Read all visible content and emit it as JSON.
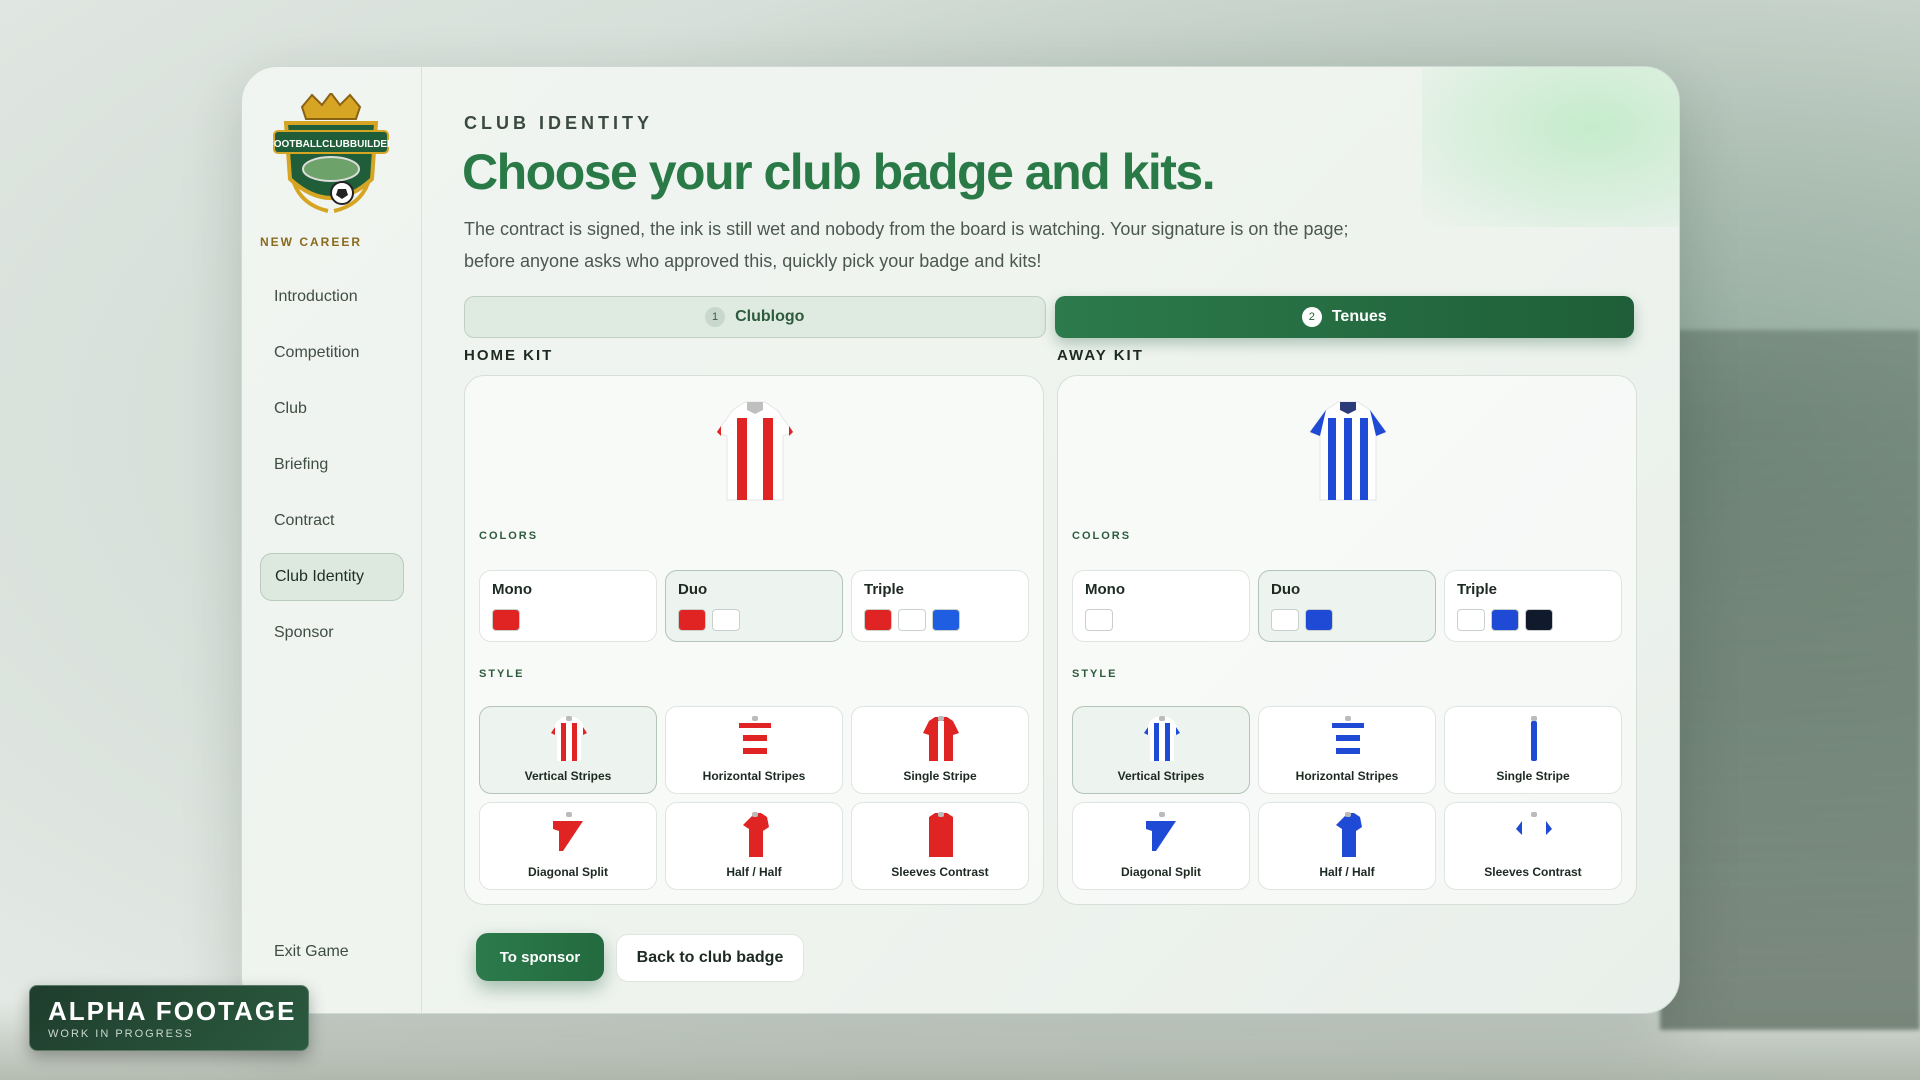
{
  "sidebar": {
    "new_career": "NEW CAREER",
    "items": [
      {
        "label": "Introduction",
        "active": false
      },
      {
        "label": "Competition",
        "active": false
      },
      {
        "label": "Club",
        "active": false
      },
      {
        "label": "Briefing",
        "active": false
      },
      {
        "label": "Contract",
        "active": false
      },
      {
        "label": "Club Identity",
        "active": true
      },
      {
        "label": "Sponsor",
        "active": false
      }
    ],
    "exit": "Exit Game"
  },
  "header": {
    "eyebrow": "CLUB IDENTITY",
    "title": "Choose your club badge and kits.",
    "description": "The contract is signed, the ink is still wet and nobody from the board is watching. Your signature is on the page; before anyone asks who approved this, quickly pick your badge and kits!"
  },
  "steps": [
    {
      "num": "1",
      "label": "Clublogo",
      "active": false
    },
    {
      "num": "2",
      "label": "Tenues",
      "active": true
    }
  ],
  "sections": {
    "colors": "COLORS",
    "style": "STYLE"
  },
  "kits": {
    "home": {
      "title": "HOME KIT",
      "colors": [
        {
          "label": "Mono",
          "swatches": [
            "#e02424"
          ]
        },
        {
          "label": "Duo",
          "swatches": [
            "#e02424",
            "#ffffff"
          ],
          "selected": true
        },
        {
          "label": "Triple",
          "swatches": [
            "#e02424",
            "#ffffff",
            "#1f5ee0"
          ]
        }
      ],
      "primary": "#e02424",
      "secondary": "#ffffff"
    },
    "away": {
      "title": "AWAY KIT",
      "colors": [
        {
          "label": "Mono",
          "swatches": [
            "#ffffff"
          ]
        },
        {
          "label": "Duo",
          "swatches": [
            "#ffffff",
            "#1f4ad6"
          ],
          "selected": true
        },
        {
          "label": "Triple",
          "swatches": [
            "#ffffff",
            "#1f4ad6",
            "#111a2c"
          ]
        }
      ],
      "primary": "#1f4ad6",
      "secondary": "#ffffff"
    }
  },
  "styles": [
    "Vertical Stripes",
    "Horizontal Stripes",
    "Single Stripe",
    "Diagonal Split",
    "Half / Half",
    "Sleeves Contrast"
  ],
  "selected_style": "Vertical Stripes",
  "actions": {
    "primary": "To sponsor",
    "secondary": "Back to club badge"
  },
  "watermark": {
    "title": "ALPHA FOOTAGE",
    "subtitle": "WORK IN PROGRESS"
  },
  "logo_text": "FOOTBALLCLUBBUILDER"
}
